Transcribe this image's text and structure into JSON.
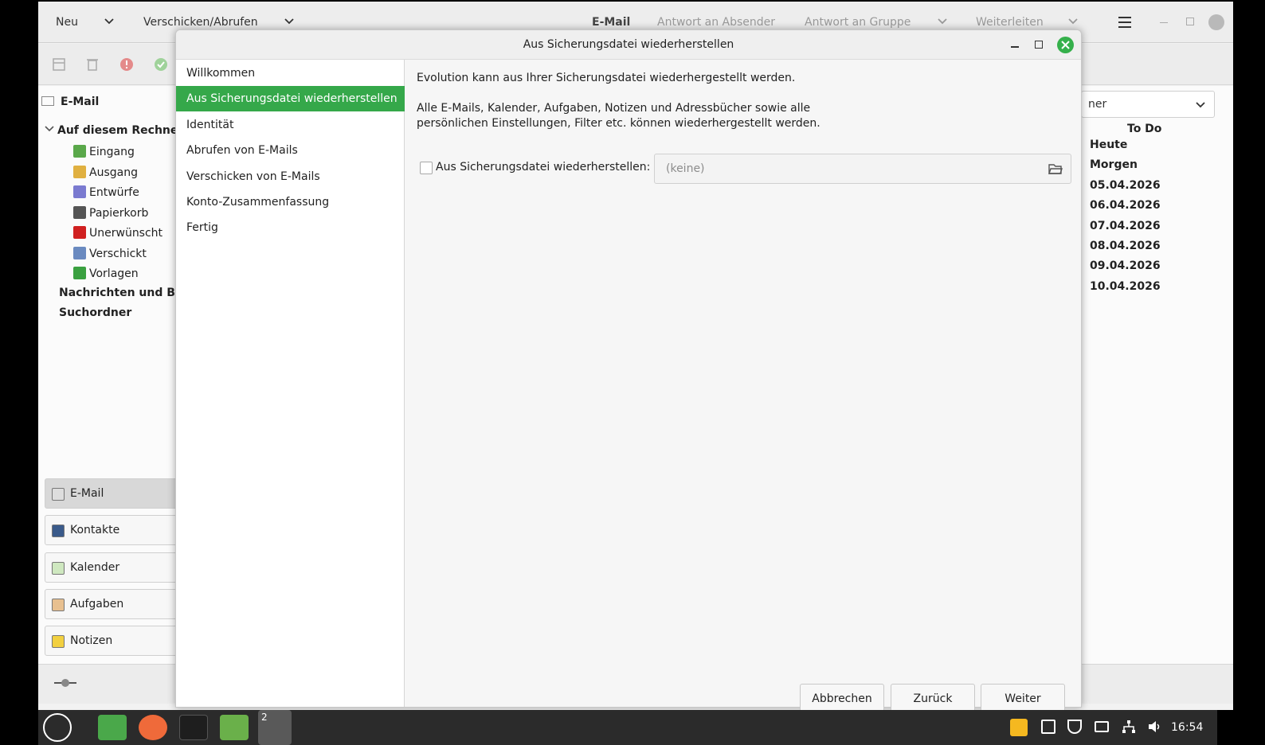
{
  "main": {
    "header": {
      "new_label": "Neu",
      "send_receive_label": "Verschicken/Abrufen",
      "email_tab": "E-Mail",
      "reply_sender": "Antwort an Absender",
      "reply_group": "Antwort an Gruppe",
      "forward": "Weiterleiten"
    },
    "sidebar": {
      "title": "E-Mail",
      "account": "Auf diesem Rechner",
      "folders": [
        {
          "label": "Eingang",
          "icon": "inbox-icon",
          "color": "#5aa84a"
        },
        {
          "label": "Ausgang",
          "icon": "outbox-icon",
          "color": "#e0b040"
        },
        {
          "label": "Entwürfe",
          "icon": "drafts-icon",
          "color": "#7a7ad0"
        },
        {
          "label": "Papierkorb",
          "icon": "trash-icon",
          "color": "#555555"
        },
        {
          "label": "Unerwünscht",
          "icon": "junk-icon",
          "color": "#d02020"
        },
        {
          "label": "Verschickt",
          "icon": "sent-icon",
          "color": "#6a8ac0"
        },
        {
          "label": "Vorlagen",
          "icon": "templates-icon",
          "color": "#3aa040"
        }
      ],
      "extra": [
        "Nachrichten und Blo",
        "Suchordner"
      ],
      "switchers": [
        {
          "label": "E-Mail",
          "icon": "mail-icon"
        },
        {
          "label": "Kontakte",
          "icon": "contacts-icon"
        },
        {
          "label": "Kalender",
          "icon": "calendar-icon"
        },
        {
          "label": "Aufgaben",
          "icon": "tasks-icon"
        },
        {
          "label": "Notizen",
          "icon": "memos-icon"
        }
      ]
    },
    "todo": {
      "select_value": "ner",
      "heading": "To Do",
      "rows": [
        "Heute",
        "Morgen",
        "05.04.2026",
        "06.04.2026",
        "07.04.2026",
        "08.04.2026",
        "09.04.2026",
        "10.04.2026"
      ]
    }
  },
  "dialog": {
    "title": "Aus Sicherungsdatei wiederherstellen",
    "steps": [
      "Willkommen",
      "Aus Sicherungsdatei wiederherstellen",
      "Identität",
      "Abrufen von E-Mails",
      "Verschicken von E-Mails",
      "Konto-Zusammenfassung",
      "Fertig"
    ],
    "active_step": 1,
    "intro": "Evolution kann aus Ihrer Sicherungsdatei wiederhergestellt werden.",
    "desc_line1": "Alle E-Mails, Kalender, Aufgaben, Notizen und Adressbücher sowie alle",
    "desc_line2": "persönlichen Einstellungen, Filter etc. können wiederhergestellt werden.",
    "restore_label": "Aus Sicherungsdatei wiederherstellen:",
    "file_value": "(keine)",
    "buttons": {
      "cancel": "Abbrechen",
      "back": "Zurück",
      "next": "Weiter"
    }
  },
  "taskbar": {
    "badge": "2",
    "clock": "16:54"
  },
  "colors": {
    "accent": "#35a84a",
    "taskbar": "#2b2b2b"
  }
}
